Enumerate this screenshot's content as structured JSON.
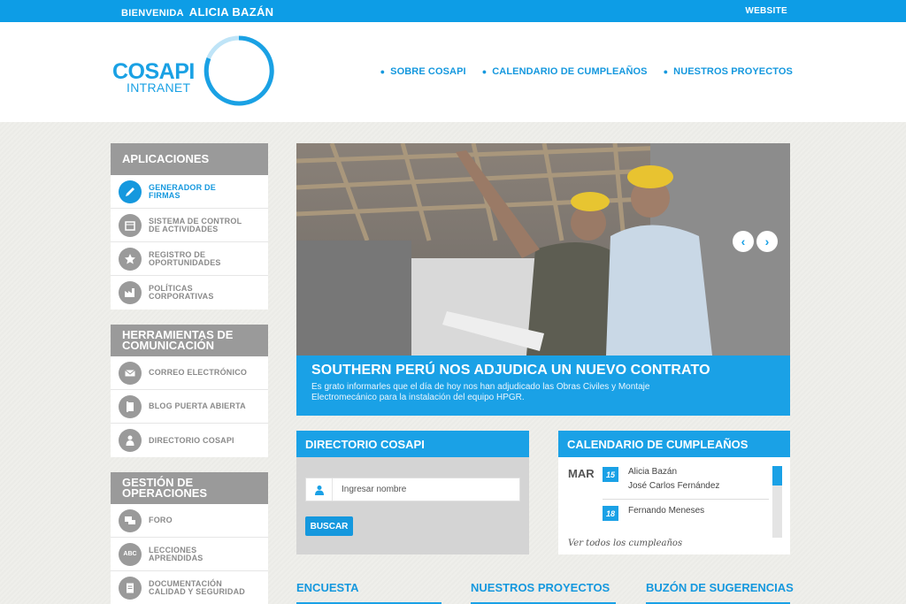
{
  "topbar": {
    "welcome_prefix": "BIENVENIDA",
    "user_name": "ALICIA BAZÁN",
    "website": "WEBSITE"
  },
  "logo": {
    "brand": "COSAPI",
    "sub": "INTRANET",
    "ring_color": "#1aa1e4"
  },
  "nav": [
    {
      "label": "SOBRE COSAPI"
    },
    {
      "label": "CALENDARIO DE CUMPLEAÑOS"
    },
    {
      "label": "NUESTROS PROYECTOS"
    }
  ],
  "sidebar": {
    "sections": [
      {
        "title": "APLICACIONES",
        "items": [
          {
            "line1": "GENERADOR DE",
            "line2": "FIRMAS",
            "icon": "pencil-icon",
            "active": true
          },
          {
            "line1": "SISTEMA DE CONTROL",
            "line2": "DE ACTIVIDADES",
            "icon": "calendar-icon"
          },
          {
            "line1": "REGISTRO DE",
            "line2": "OPORTUNIDADES",
            "icon": "star-icon"
          },
          {
            "line1": "POLÍTICAS",
            "line2": "CORPORATIVAS",
            "icon": "factory-icon"
          }
        ]
      },
      {
        "title_line1": "HERRAMIENTAS DE",
        "title_line2": "COMUNICACIÓN",
        "items": [
          {
            "line1": "CORREO ELECTRÓNICO",
            "icon": "envelope-icon"
          },
          {
            "line1": "BLOG PUERTA ABIERTA",
            "icon": "door-icon"
          },
          {
            "line1": "DIRECTORIO COSAPI",
            "icon": "people-icon"
          }
        ]
      },
      {
        "title_line1": "GESTIÓN DE",
        "title_line2": "OPERACIONES",
        "items": [
          {
            "line1": "FORO",
            "icon": "chat-icon"
          },
          {
            "line1": "LECCIONES",
            "line2": "APRENDIDAS",
            "icon": "abc-icon"
          },
          {
            "line1": "DOCUMENTACIÓN",
            "line2": "CALIDAD Y SEGURIDAD",
            "icon": "document-icon"
          }
        ]
      }
    ]
  },
  "hero": {
    "title": "SOUTHERN PERÚ NOS ADJUDICA UN NUEVO CONTRATO",
    "description": "Es grato informarles que el día de hoy nos han adjudicado las Obras Civiles y Montaje Electromecánico para la instalación del equipo HPGR.",
    "prev": "‹",
    "next": "›"
  },
  "directorio": {
    "title": "DIRECTORIO COSAPI",
    "placeholder": "Ingresar nombre",
    "button": "BUSCAR"
  },
  "cumpleanos": {
    "title": "CALENDARIO DE CUMPLEAÑOS",
    "month": "MAR",
    "entries": [
      {
        "day": "15",
        "names": [
          "Alicia Bazán",
          "José Carlos Fernández"
        ]
      },
      {
        "day": "18",
        "names": [
          "Fernando Meneses"
        ]
      }
    ],
    "more": "Ver todos los cumpleaños"
  },
  "bottom": {
    "encuesta": "ENCUESTA",
    "proyectos": "NUESTROS PROYECTOS",
    "buzon": "BUZÓN DE SUGERENCIAS"
  },
  "colors": {
    "accent": "#1aa1e6",
    "sidebar_head": "#9a9a9a"
  }
}
